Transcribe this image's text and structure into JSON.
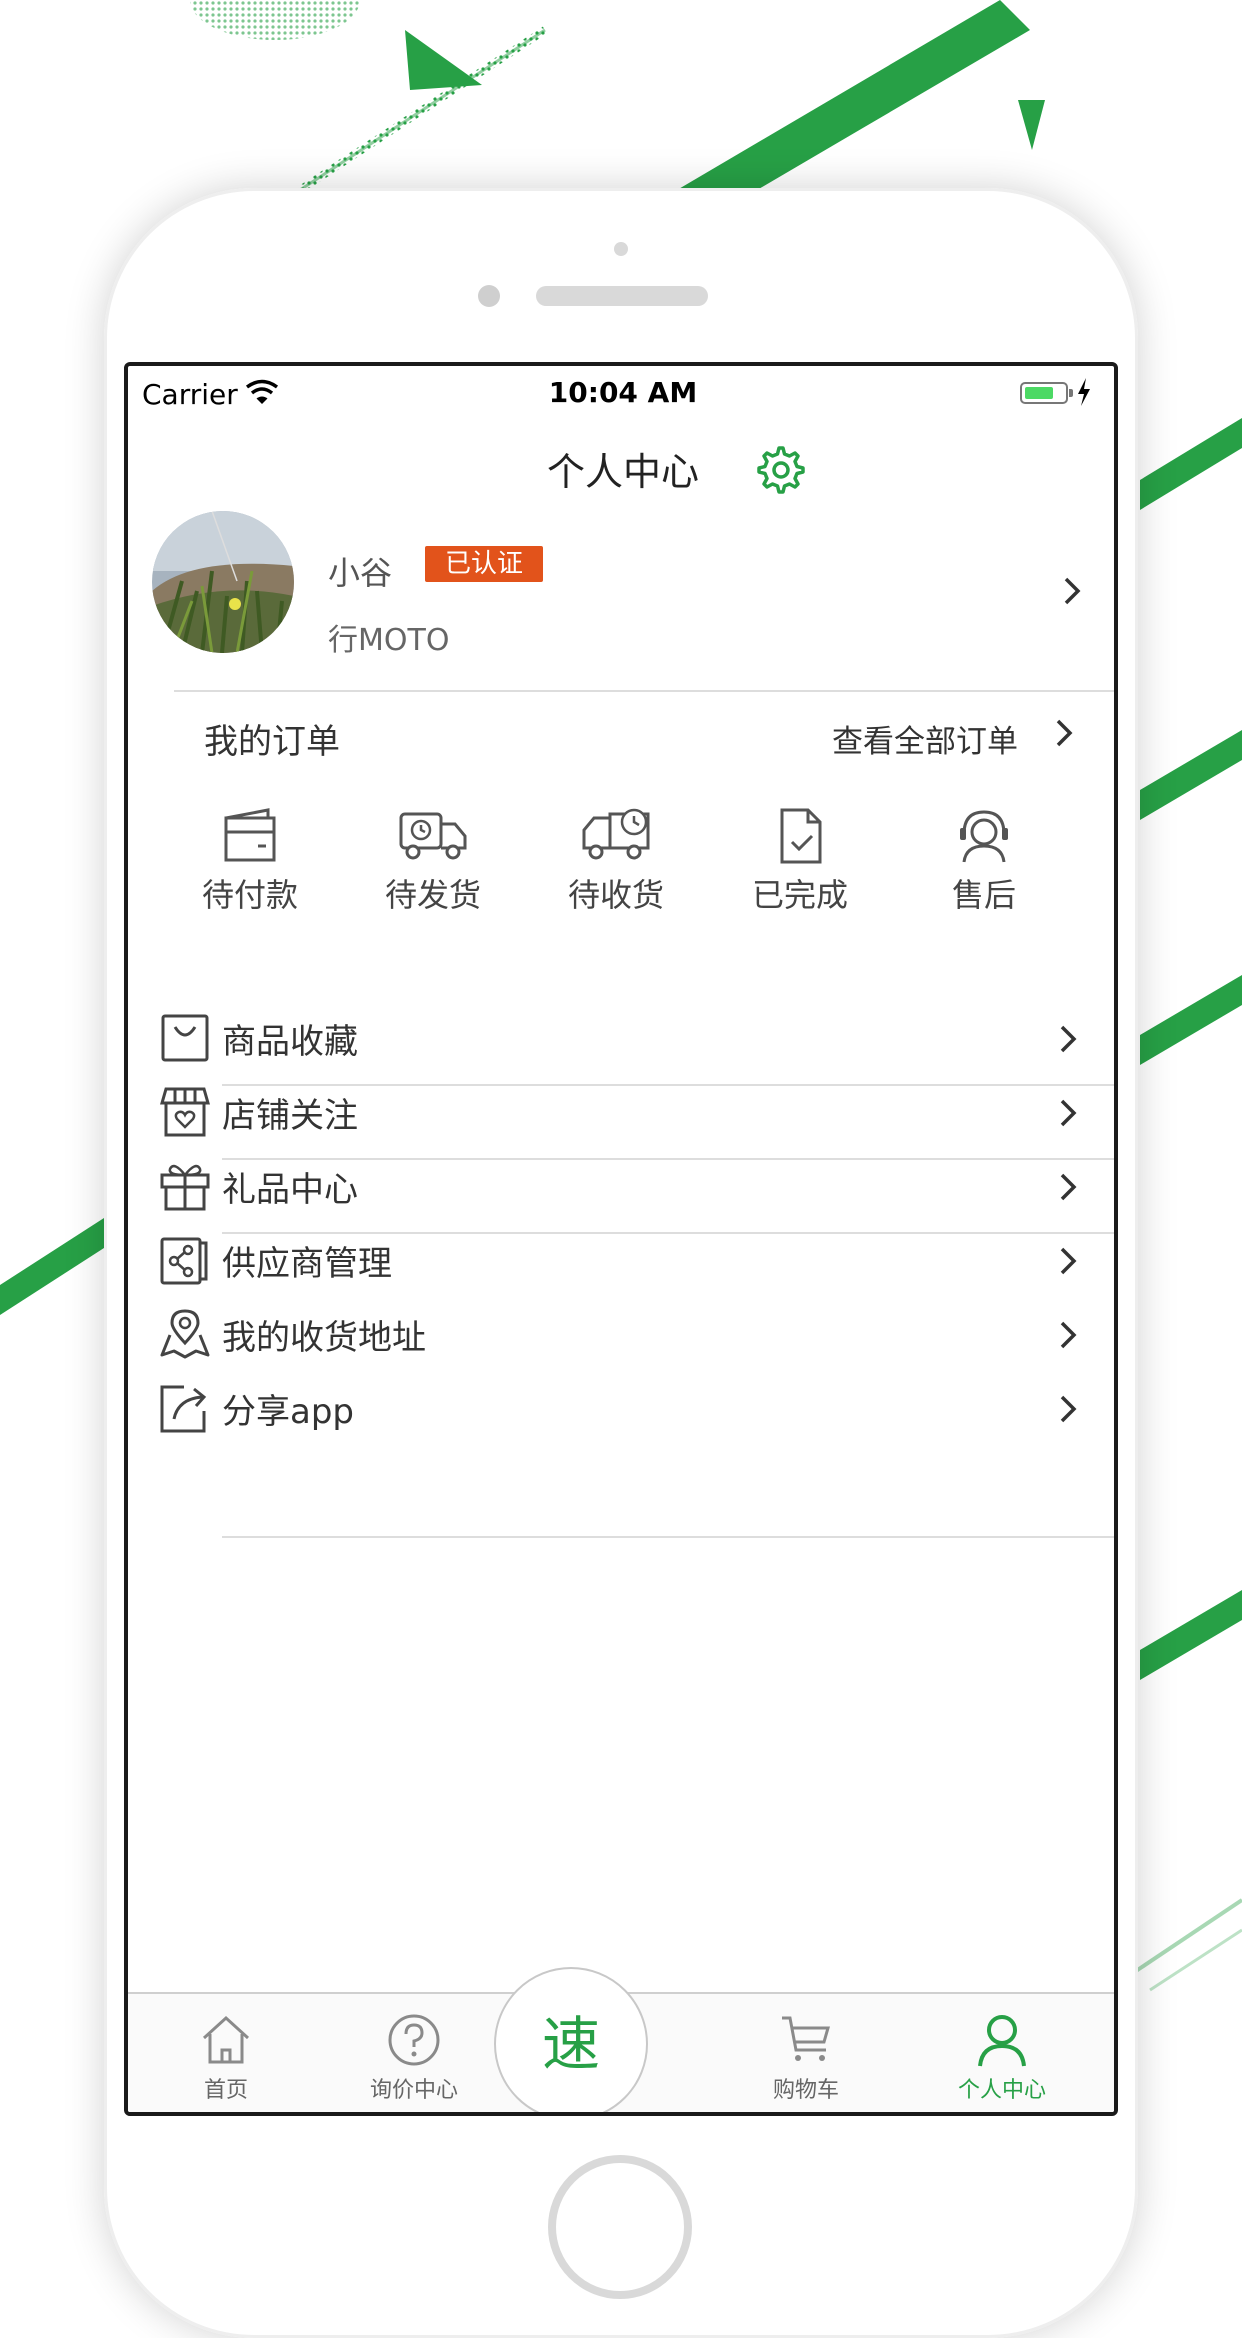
{
  "status_bar": {
    "carrier": "Carrier",
    "time": "10:04 AM"
  },
  "header": {
    "title": "个人中心"
  },
  "profile": {
    "name": "小谷",
    "badge": "已认证",
    "subtitle": "行MOTO"
  },
  "orders": {
    "title": "我的订单",
    "view_all": "查看全部订单",
    "items": [
      {
        "label": "待付款",
        "icon": "wallet-icon"
      },
      {
        "label": "待发货",
        "icon": "truck-icon"
      },
      {
        "label": "待收货",
        "icon": "delivery-clock-icon"
      },
      {
        "label": "已完成",
        "icon": "document-check-icon"
      },
      {
        "label": "售后",
        "icon": "headset-icon"
      }
    ]
  },
  "menu": [
    {
      "label": "商品收藏",
      "icon": "bag-icon"
    },
    {
      "label": "店铺关注",
      "icon": "store-icon"
    },
    {
      "label": "礼品中心",
      "icon": "gift-icon"
    },
    {
      "label": "供应商管理",
      "icon": "share-doc-icon"
    },
    {
      "label": "我的收货地址",
      "icon": "location-map-icon"
    },
    {
      "label": "分享app",
      "icon": "export-icon"
    }
  ],
  "tabbar": {
    "items": [
      {
        "label": "首页",
        "icon": "home-icon"
      },
      {
        "label": "询价中心",
        "icon": "question-icon"
      },
      {
        "label": "购物车",
        "icon": "cart-icon"
      },
      {
        "label": "个人中心",
        "icon": "user-icon",
        "active": true
      }
    ],
    "center_label": "速"
  },
  "colors": {
    "accent": "#27a046",
    "badge": "#e2531b",
    "text": "#333333",
    "divider": "#dddddd"
  }
}
